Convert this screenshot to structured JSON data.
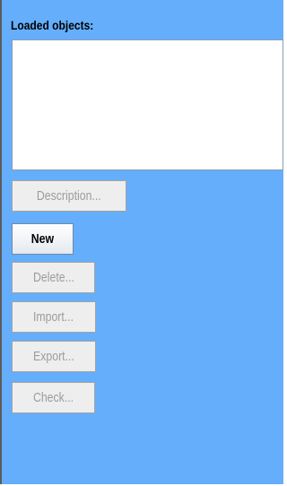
{
  "panel": {
    "title": "Loaded objects:",
    "buttons": {
      "description": "Description...",
      "new": "New",
      "delete": "Delete...",
      "import": "Import...",
      "export": "Export...",
      "check": "Check..."
    }
  }
}
